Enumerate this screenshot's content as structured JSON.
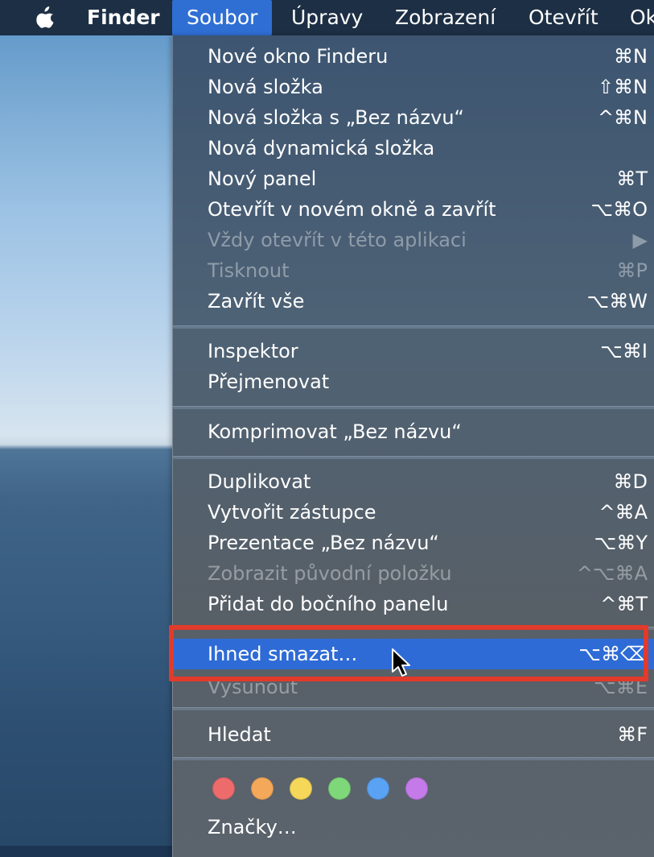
{
  "menubar": {
    "items": [
      "Finder",
      "Soubor",
      "Úpravy",
      "Zobrazení",
      "Otevřít",
      "Ok"
    ]
  },
  "menu": {
    "items": [
      {
        "label": "Nové okno Finderu",
        "shortcut": "⌘N"
      },
      {
        "label": "Nová složka",
        "shortcut": "⇧⌘N"
      },
      {
        "label": "Nová složka s „Bez názvu“",
        "shortcut": "^⌘N"
      },
      {
        "label": "Nová dynamická složka",
        "shortcut": ""
      },
      {
        "label": "Nový panel",
        "shortcut": "⌘T"
      },
      {
        "label": "Otevřít v novém okně a zavřít",
        "shortcut": "⌥⌘O"
      },
      {
        "label": "Vždy otevřít v této aplikaci",
        "shortcut": "▶"
      },
      {
        "label": "Tisknout",
        "shortcut": "⌘P"
      },
      {
        "label": "Zavřít vše",
        "shortcut": "⌥⌘W"
      },
      {
        "label": "Inspektor",
        "shortcut": "⌥⌘I"
      },
      {
        "label": "Přejmenovat",
        "shortcut": ""
      },
      {
        "label": "Komprimovat „Bez názvu“",
        "shortcut": ""
      },
      {
        "label": "Duplikovat",
        "shortcut": "⌘D"
      },
      {
        "label": "Vytvořit zástupce",
        "shortcut": "^⌘A"
      },
      {
        "label": "Prezentace „Bez názvu“",
        "shortcut": "⌥⌘Y"
      },
      {
        "label": "Zobrazit původní položku",
        "shortcut": "^⌥⌘A"
      },
      {
        "label": "Přidat do bočního panelu",
        "shortcut": "^⌘T"
      },
      {
        "label": "Ihned smazat…",
        "shortcut": "⌥⌘⌫"
      },
      {
        "label": "Vysunout",
        "shortcut": "⌥⌘E"
      },
      {
        "label": "Hledat",
        "shortcut": "⌘F"
      },
      {
        "label": "Značky…",
        "shortcut": ""
      }
    ],
    "tag_colors": [
      "#ee6b6b",
      "#f3a85a",
      "#f5d75a",
      "#7ed87a",
      "#5aa2f3",
      "#c47ae8"
    ],
    "highlight_color": "#2e6bd6"
  },
  "annotation": {
    "color": "#e23a2b"
  }
}
